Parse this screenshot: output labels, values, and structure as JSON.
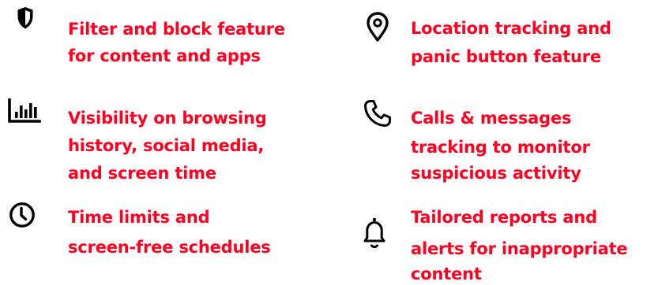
{
  "accent_color": "#ff0021",
  "icon_color": "#000000",
  "features": [
    {
      "icon": "shield-icon",
      "lines": [
        "Filter and block feature",
        "for content and apps"
      ]
    },
    {
      "icon": "location-pin-icon",
      "lines": [
        "Location tracking and",
        "panic button feature"
      ]
    },
    {
      "icon": "bar-chart-icon",
      "lines": [
        "Visibility on browsing",
        "history, social media,",
        "and screen time"
      ]
    },
    {
      "icon": "phone-icon",
      "lines": [
        "Calls & messages",
        "tracking to monitor",
        "suspicious activity"
      ]
    },
    {
      "icon": "clock-icon",
      "lines": [
        "Time limits and",
        "screen-free schedules"
      ]
    },
    {
      "icon": "bell-icon",
      "lines": [
        "Tailored reports and",
        "alerts for inappropriate",
        "content"
      ]
    }
  ]
}
